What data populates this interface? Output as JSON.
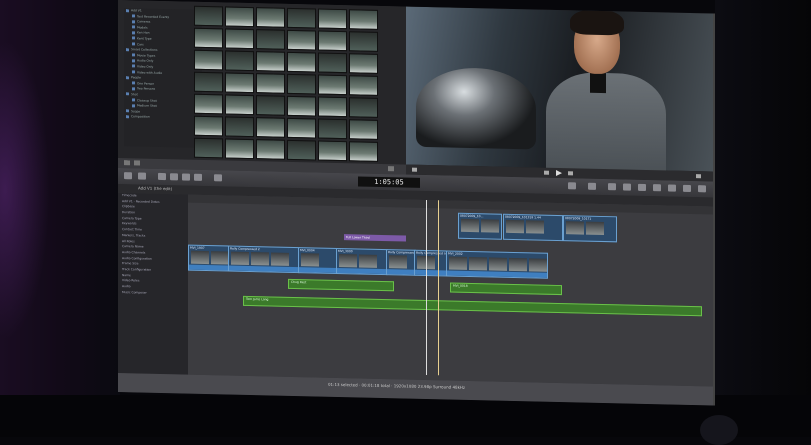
{
  "viewer": {
    "timecode": "1:05:05"
  },
  "library": {
    "items": [
      "Add V1",
      "Text Recorded Events",
      "Cameras",
      "Models",
      "Ken Hon",
      "Kent Type",
      "Cars",
      "Smart Collections",
      "Movie Types",
      "Audio Only",
      "Video Only",
      "Video with Audio",
      "People",
      "One Person",
      "Two Persons",
      "Shot",
      "Closeup Shot",
      "Medium Shot",
      "Scope",
      "Composition"
    ]
  },
  "timeline": {
    "project_name": "Add V1 (the edit)",
    "title_clip": "Full Lower Third",
    "clips": [
      "MVI_1907",
      "Rally Compressed 2",
      "MVI_0004",
      "MVI_3000",
      "Rally Compressed 2",
      "Rally Compressed auto",
      "MVI_2002"
    ],
    "connected_clips": [
      "08072009_10...",
      "08072009_101318 1.44",
      "08072009_10171"
    ],
    "audio_clips": [
      "Chug Rest",
      "MVI_0018",
      "Tom Jams Long"
    ]
  },
  "inspector": {
    "rows": [
      "Timecode",
      "Add V1 - Recorded Dates",
      "Clipbase",
      "Duration",
      "Camera Type",
      "Keywords",
      "Contact Time",
      "Markers, Tracks",
      "All Roles",
      "Camera Name",
      "Audio Channels",
      "Audio Configuration",
      "Frame Size",
      "Track Configuration",
      "Name",
      "Video Roles",
      "Audio",
      "Music Composer"
    ]
  },
  "status_text": "01:13 selected · 00:01:18 total · 1920x1080 23.98p Surround 48kHz"
}
